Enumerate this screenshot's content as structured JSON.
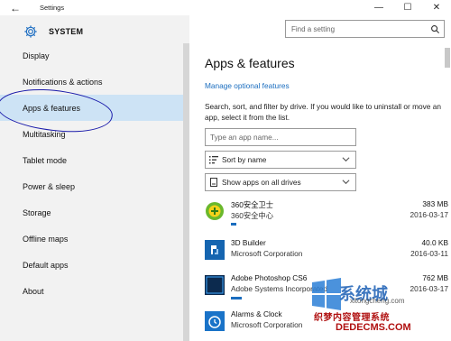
{
  "window": {
    "title": "Settings",
    "back_glyph": "←",
    "minimize_glyph": "—",
    "maximize_glyph": "☐",
    "close_glyph": "✕"
  },
  "search": {
    "placeholder": "Find a setting",
    "icon": "search-icon"
  },
  "sidebar": {
    "brand": "SYSTEM",
    "brand_icon": "gear-icon",
    "items": [
      {
        "label": "Display"
      },
      {
        "label": "Notifications & actions"
      },
      {
        "label": "Apps & features",
        "selected": true
      },
      {
        "label": "Multitasking"
      },
      {
        "label": "Tablet mode"
      },
      {
        "label": "Power & sleep"
      },
      {
        "label": "Storage"
      },
      {
        "label": "Offline maps"
      },
      {
        "label": "Default apps"
      },
      {
        "label": "About"
      }
    ]
  },
  "main": {
    "title": "Apps & features",
    "manage_link": "Manage optional features",
    "description": "Search, sort, and filter by drive. If you would like to uninstall or move an app, select it from the list.",
    "search_placeholder": "Type an app name...",
    "sort_label": "Sort by name",
    "filter_label": "Show apps on all drives",
    "apps": [
      {
        "name": "360安全卫士",
        "publisher": "360安全中心",
        "size": "383 MB",
        "date": "2016-03-17",
        "bar_fraction": 0.06
      },
      {
        "name": "3D Builder",
        "publisher": "Microsoft Corporation",
        "size": "40.0 KB",
        "date": "2016-03-11",
        "bar_fraction": 0.0
      },
      {
        "name": "Adobe Photoshop CS6",
        "publisher": "Adobe Systems Incorporated",
        "size": "762 MB",
        "date": "2016-03-17",
        "bar_fraction": 0.12
      },
      {
        "name": "Alarms & Clock",
        "publisher": "Microsoft Corporation",
        "size": "",
        "date": "",
        "bar_fraction": 0.0
      }
    ]
  },
  "watermark": {
    "line1": "系统城",
    "line2": "织梦内容管理系统",
    "line3": "DEDECMS.COM",
    "line4": "xitongcheng.com"
  },
  "colors": {
    "accent": "#1a6dbf",
    "selected_bg": "#cde3f5",
    "sidebar_bg": "#f2f2f2",
    "annotation": "#1a1aaa"
  }
}
